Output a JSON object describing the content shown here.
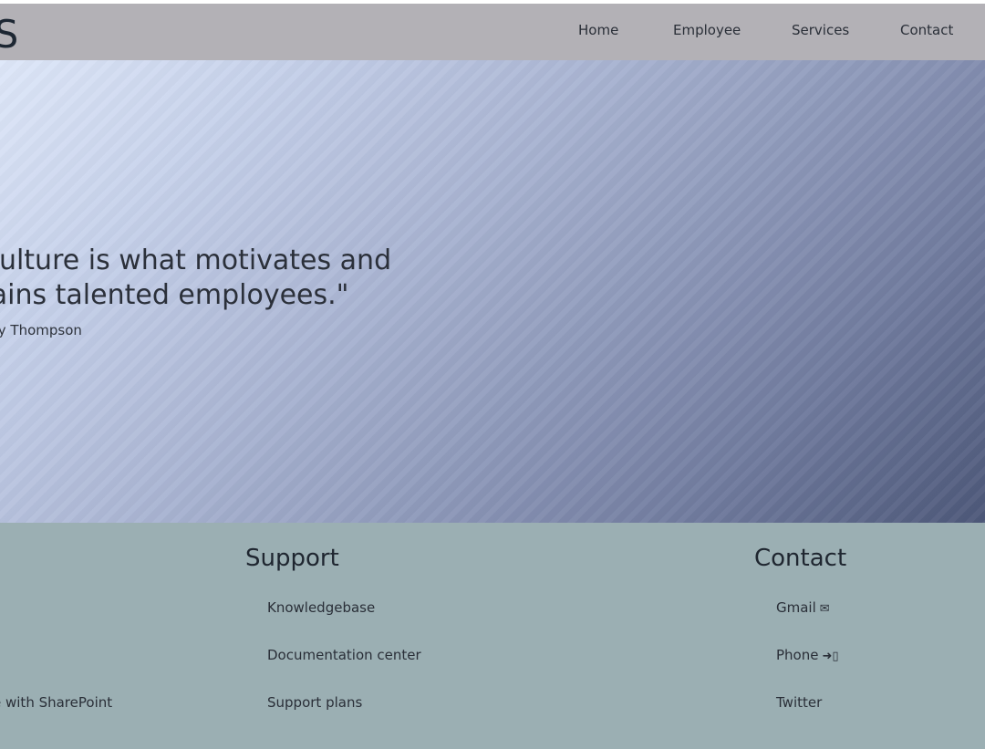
{
  "header": {
    "logo": "SS",
    "nav": [
      "Home",
      "Employee",
      "Services",
      "Contact"
    ]
  },
  "hero": {
    "quote_line1": "Culture is what motivates and",
    "quote_line2": "tains talented employees.\"",
    "author": "tty Thompson"
  },
  "footer": {
    "left_link": "e with SharePoint",
    "support": {
      "title": "Support",
      "links": [
        "Knowledgebase",
        "Documentation center",
        "Support plans"
      ]
    },
    "contact": {
      "title": "Contact",
      "links": [
        {
          "label": "Gmail",
          "icon": "✉"
        },
        {
          "label": "Phone",
          "icon": "➜▯"
        },
        {
          "label": "Twitter",
          "icon": ""
        }
      ]
    }
  }
}
